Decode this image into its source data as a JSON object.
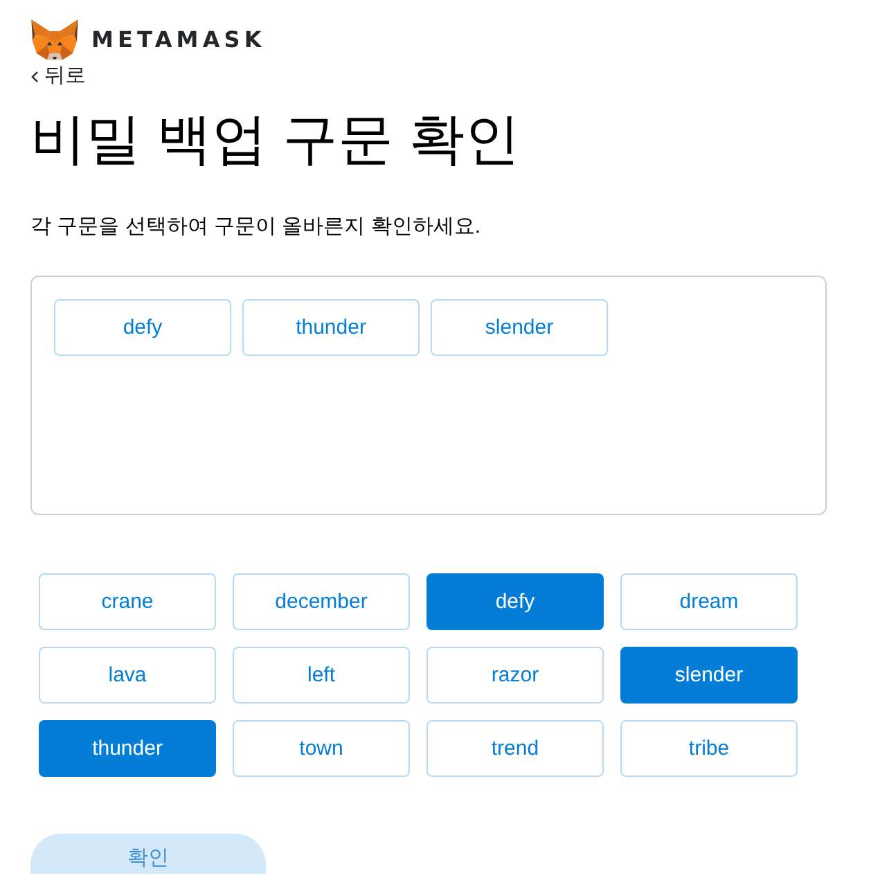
{
  "header": {
    "logo_text": "METAMASK"
  },
  "back_link": {
    "label": "뒤로"
  },
  "title": "비밀 백업 구문 확인",
  "instructions": "각 구문을 선택하여 구문이 올바른지 확인하세요.",
  "selected_words": [
    "defy",
    "thunder",
    "slender"
  ],
  "word_options": [
    {
      "label": "crane",
      "selected": false
    },
    {
      "label": "december",
      "selected": false
    },
    {
      "label": "defy",
      "selected": true
    },
    {
      "label": "dream",
      "selected": false
    },
    {
      "label": "lava",
      "selected": false
    },
    {
      "label": "left",
      "selected": false
    },
    {
      "label": "razor",
      "selected": false
    },
    {
      "label": "slender",
      "selected": true
    },
    {
      "label": "thunder",
      "selected": true
    },
    {
      "label": "town",
      "selected": false
    },
    {
      "label": "trend",
      "selected": false
    },
    {
      "label": "tribe",
      "selected": false
    }
  ],
  "confirm_button": {
    "label": "확인",
    "disabled": true
  }
}
